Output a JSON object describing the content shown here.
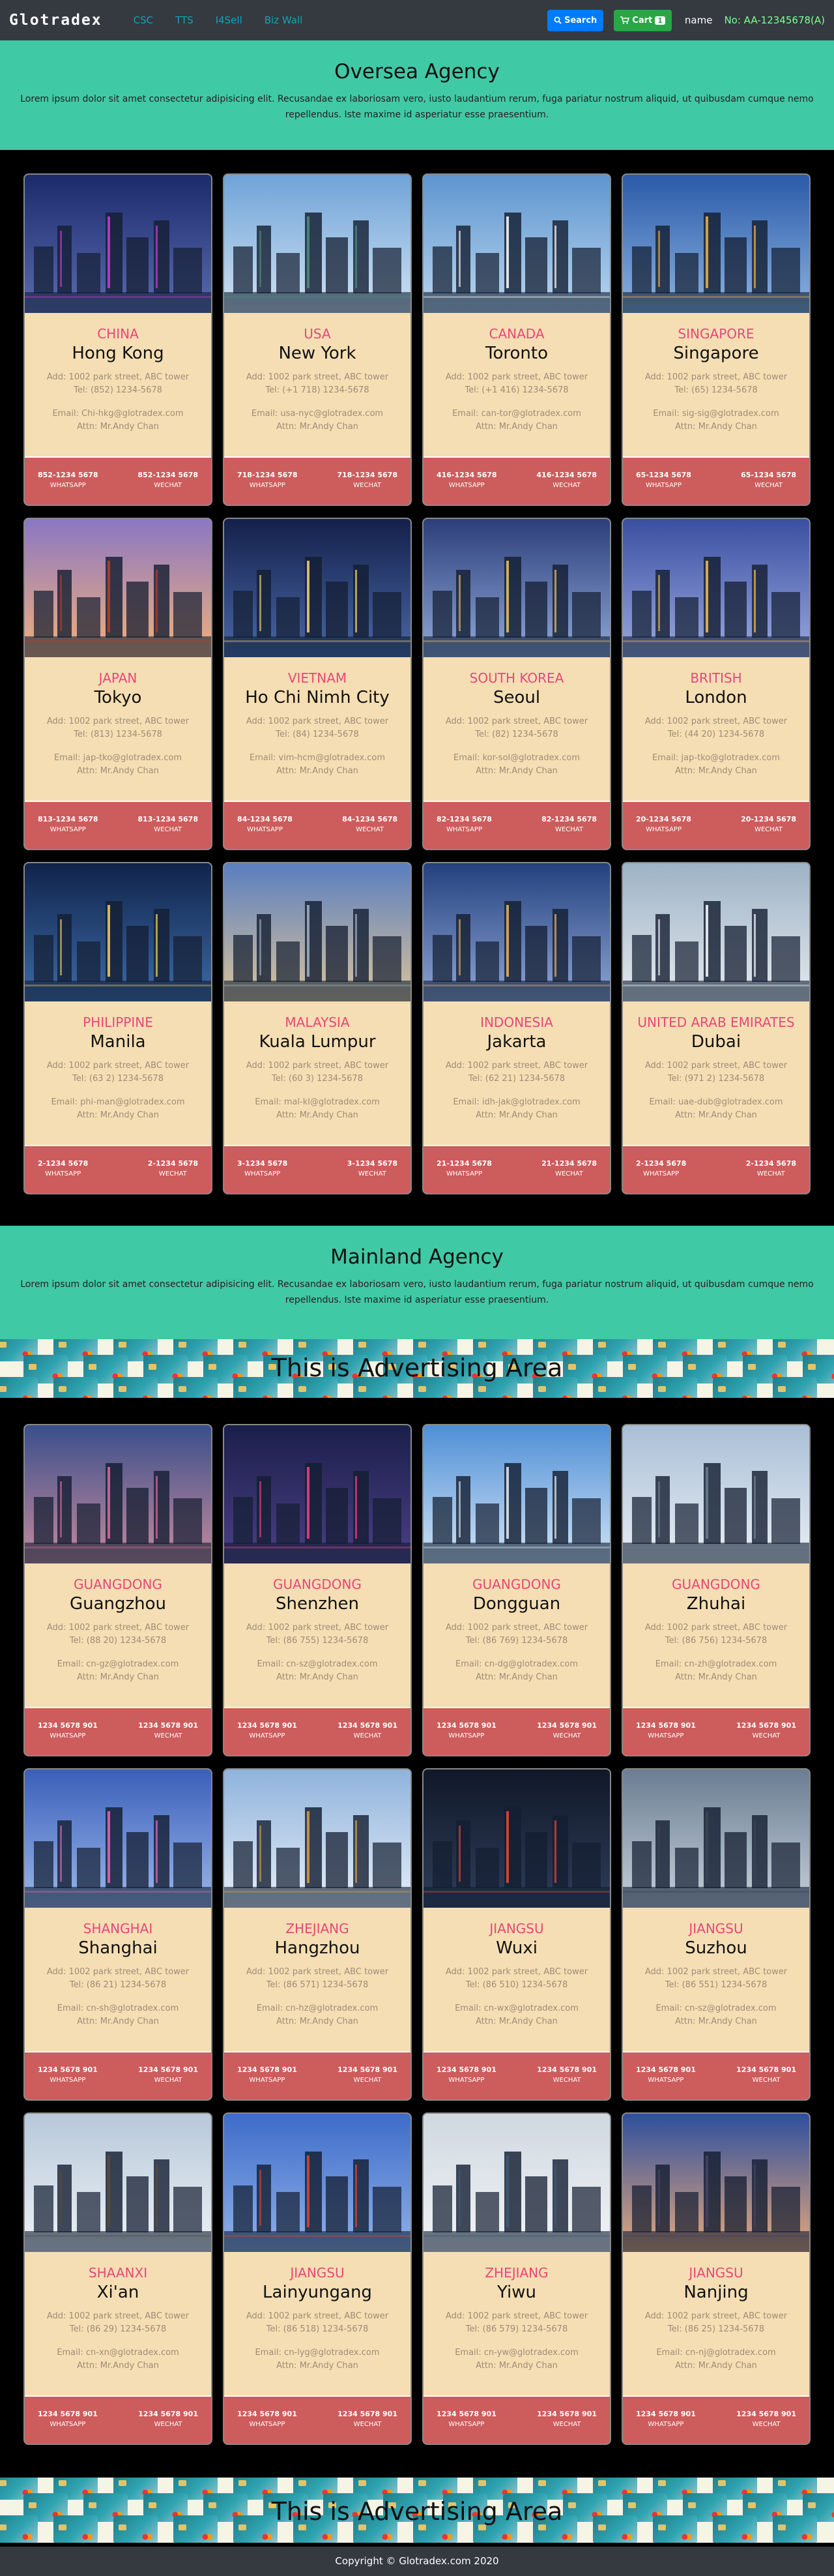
{
  "navbar": {
    "brand": "Glotradex",
    "links": [
      "CSC",
      "TTS",
      "I4Sell",
      "Biz Wall"
    ],
    "search_label": "Search",
    "cart_label": "Cart",
    "cart_count": "1",
    "user_name": "name",
    "user_no": "No: AA-12345678(A)"
  },
  "oversea": {
    "title": "Oversea Agency",
    "desc": "Lorem ipsum dolor sit amet consectetur adipisicing elit. Recusandae ex laboriosam vero, iusto laudantium rerum, fuga pariatur nostrum aliquid, ut quibusdam cumque nemo repellendus. Iste maxime id asperiatur esse praesentium.",
    "cards": [
      {
        "country": "CHINA",
        "city": "Hong Kong",
        "addr": "Add: 1002 park street, ABC tower",
        "tel": "Tel: (852) 1234-5678",
        "email": "Email: Chi-hkg@glotradex.com",
        "attn": "Attn: Mr.Andy Chan",
        "wa": "852-1234 5678",
        "wc": "852-1234 5678",
        "wa_label": "WHATSAPP",
        "wc_label": "WECHAT",
        "sky": [
          "#1b2a6b",
          "#5b6bb0"
        ],
        "accent": "#d23ad0"
      },
      {
        "country": "USA",
        "city": "New York",
        "addr": "Add: 1002 park street, ABC tower",
        "tel": "Tel: (+1 718) 1234-5678",
        "email": "Email: usa-nyc@glotradex.com",
        "attn": "Attn: Mr.Andy Chan",
        "wa": "718-1234 5678",
        "wc": "718-1234 5678",
        "wa_label": "WHATSAPP",
        "wc_label": "WECHAT",
        "sky": [
          "#6fa3d8",
          "#cfe2f2"
        ],
        "accent": "#4b8f7c"
      },
      {
        "country": "CANADA",
        "city": "Toronto",
        "addr": "Add: 1002 park street, ABC tower",
        "tel": "Tel: (+1 416) 1234-5678",
        "email": "Email: can-tor@glotradex.com",
        "attn": "Attn: Mr.Andy Chan",
        "wa": "416-1234 5678",
        "wc": "416-1234 5678",
        "wa_label": "WHATSAPP",
        "wc_label": "WECHAT",
        "sky": [
          "#5d95cf",
          "#b9d6ee"
        ],
        "accent": "#ffffff"
      },
      {
        "country": "SINGAPORE",
        "city": "Singapore",
        "addr": "Add: 1002 park street, ABC tower",
        "tel": "Tel: (65) 1234-5678",
        "email": "Email: sig-sig@glotradex.com",
        "attn": "Attn: Mr.Andy Chan",
        "wa": "65-1234 5678",
        "wc": "65-1234 5678",
        "wa_label": "WHATSAPP",
        "wc_label": "WECHAT",
        "sky": [
          "#2a5aa8",
          "#8bb3e2"
        ],
        "accent": "#f2b540"
      },
      {
        "country": "JAPAN",
        "city": "Tokyo",
        "addr": "Add: 1002 park street, ABC tower",
        "tel": "Tel: (813) 1234-5678",
        "email": "Email: jap-tko@glotradex.com",
        "attn": "Attn: Mr.Andy Chan",
        "wa": "813-1234 5678",
        "wc": "813-1234 5678",
        "wa_label": "WHATSAPP",
        "wc_label": "WECHAT",
        "sky": [
          "#8a77c4",
          "#f2b07a"
        ],
        "accent": "#c0392b"
      },
      {
        "country": "VIETNAM",
        "city": "Ho Chi Nimh City",
        "addr": "Add: 1002 park street, ABC tower",
        "tel": "Tel: (84) 1234-5678",
        "email": "Email: vim-hcm@glotradex.com",
        "attn": "Attn: Mr.Andy Chan",
        "wa": "84-1234 5678",
        "wc": "84-1234 5678",
        "wa_label": "WHATSAPP",
        "wc_label": "WECHAT",
        "sky": [
          "#14204a",
          "#4968a8"
        ],
        "accent": "#f5d76e"
      },
      {
        "country": "SOUTH KOREA",
        "city": "Seoul",
        "addr": "Add: 1002 park street, ABC tower",
        "tel": "Tel: (82) 1234-5678",
        "email": "Email: kor-sol@glotradex.com",
        "attn": "Attn: Mr.Andy Chan",
        "wa": "82-1234 5678",
        "wc": "82-1234 5678",
        "wa_label": "WHATSAPP",
        "wc_label": "WECHAT",
        "sky": [
          "#2c3e7a",
          "#8fa8d8"
        ],
        "accent": "#f0c36a"
      },
      {
        "country": "BRITISH",
        "city": "London",
        "addr": "Add: 1002 park street, ABC tower",
        "tel": "Tel: (44 20) 1234-5678",
        "email": "Email: jap-tko@glotradex.com",
        "attn": "Attn: Mr.Andy Chan",
        "wa": "20-1234 5678",
        "wc": "20-1234 5678",
        "wa_label": "WHATSAPP",
        "wc_label": "WECHAT",
        "sky": [
          "#3a4fa0",
          "#9aa8e0"
        ],
        "accent": "#f3c04a"
      },
      {
        "country": "PHILIPPINE",
        "city": "Manila",
        "addr": "Add: 1002 park street, ABC tower",
        "tel": "Tel: (63 2) 1234-5678",
        "email": "Email: phi-man@glotradex.com",
        "attn": "Attn: Mr.Andy Chan",
        "wa": "2-1234 5678",
        "wc": "2-1234 5678",
        "wa_label": "WHATSAPP",
        "wc_label": "WECHAT",
        "sky": [
          "#10244a",
          "#3d6aa8"
        ],
        "accent": "#f4d25a"
      },
      {
        "country": "MALAYSIA",
        "city": "Kuala Lumpur",
        "addr": "Add: 1002 park street, ABC tower",
        "tel": "Tel: (60 3) 1234-5678",
        "email": "Email: mal-kl@glotradex.com",
        "attn": "Attn: Mr.Andy Chan",
        "wa": "3-1234 5678",
        "wc": "3-1234 5678",
        "wa_label": "WHATSAPP",
        "wc_label": "WECHAT",
        "sky": [
          "#5a7ec0",
          "#d9c49a"
        ],
        "accent": "#a4b3c4"
      },
      {
        "country": "INDONESIA",
        "city": "Jakarta",
        "addr": "Add: 1002 park street, ABC tower",
        "tel": "Tel: (62 21) 1234-5678",
        "email": "Email: idh-jak@glotradex.com",
        "attn": "Attn: Mr.Andy Chan",
        "wa": "21-1234 5678",
        "wc": "21-1234 5678",
        "wa_label": "WHATSAPP",
        "wc_label": "WECHAT",
        "sky": [
          "#24417e",
          "#8ea6d6"
        ],
        "accent": "#e8b66a"
      },
      {
        "country": "UNITED ARAB EMIRATES",
        "city": "Dubai",
        "addr": "Add: 1002 park street, ABC tower",
        "tel": "Tel: (971 2) 1234-5678",
        "email": "Email: uae-dub@glotradex.com",
        "attn": "Attn: Mr.Andy Chan",
        "wa": "2-1234 5678",
        "wc": "2-1234 5678",
        "wa_label": "WHATSAPP",
        "wc_label": "WECHAT",
        "sky": [
          "#9eb3c6",
          "#e4e9ee"
        ],
        "accent": "#ffffff"
      }
    ]
  },
  "mainland": {
    "title": "Mainland Agency",
    "desc": "Lorem ipsum dolor sit amet consectetur adipisicing elit. Recusandae ex laboriosam vero, iusto laudantium rerum, fuga pariatur nostrum aliquid, ut quibusdam cumque nemo repellendus. Iste maxime id asperiatur esse praesentium.",
    "cards": [
      {
        "country": "GUANGDONG",
        "city": "Guangzhou",
        "addr": "Add: 1002 park street, ABC tower",
        "tel": "Tel: (88 20) 1234-5678",
        "email": "Email: cn-gz@glotradex.com",
        "attn": "Attn: Mr.Andy Chan",
        "wa": "1234 5678 901",
        "wc": "1234 5678 901",
        "wa_label": "WHATSAPP",
        "wc_label": "WECHAT",
        "sky": [
          "#3a4f8a",
          "#c58a9e"
        ],
        "accent": "#e46aa0"
      },
      {
        "country": "GUANGDONG",
        "city": "Shenzhen",
        "addr": "Add: 1002 park street, ABC tower",
        "tel": "Tel: (86 755) 1234-5678",
        "email": "Email: cn-sz@glotradex.com",
        "attn": "Attn: Mr.Andy Chan",
        "wa": "1234 5678 901",
        "wc": "1234 5678 901",
        "wa_label": "WHATSAPP",
        "wc_label": "WECHAT",
        "sky": [
          "#1a1f4a",
          "#4c3f86"
        ],
        "accent": "#ff3b8a"
      },
      {
        "country": "GUANGDONG",
        "city": "Dongguan",
        "addr": "Add: 1002 park street, ABC tower",
        "tel": "Tel: (86 769) 1234-5678",
        "email": "Email: cn-dg@glotradex.com",
        "attn": "Attn: Mr.Andy Chan",
        "wa": "1234 5678 901",
        "wc": "1234 5678 901",
        "wa_label": "WHATSAPP",
        "wc_label": "WECHAT",
        "sky": [
          "#4f8fd6",
          "#cfe3f5"
        ],
        "accent": "#e8eef4"
      },
      {
        "country": "GUANGDONG",
        "city": "Zhuhai",
        "addr": "Add: 1002 park street, ABC tower",
        "tel": "Tel: (86 756) 1234-5678",
        "email": "Email: cn-zh@glotradex.com",
        "attn": "Attn: Mr.Andy Chan",
        "wa": "1234 5678 901",
        "wc": "1234 5678 901",
        "wa_label": "WHATSAPP",
        "wc_label": "WECHAT",
        "sky": [
          "#a9bfd6",
          "#e8eef4"
        ],
        "accent": "#6c7f92"
      },
      {
        "country": "SHANGHAI",
        "city": "Shanghai",
        "addr": "Add: 1002 park street, ABC tower",
        "tel": "Tel: (86 21) 1234-5678",
        "email": "Email: cn-sh@glotradex.com",
        "attn": "Attn: Mr.Andy Chan",
        "wa": "1234 5678 901",
        "wc": "1234 5678 901",
        "wa_label": "WHATSAPP",
        "wc_label": "WECHAT",
        "sky": [
          "#3b5fb8",
          "#9bb7ec"
        ],
        "accent": "#e66ab8"
      },
      {
        "country": "ZHEJIANG",
        "city": "Hangzhou",
        "addr": "Add: 1002 park street, ABC tower",
        "tel": "Tel: (86 571) 1234-5678",
        "email": "Email: cn-hz@glotradex.com",
        "attn": "Attn: Mr.Andy Chan",
        "wa": "1234 5678 901",
        "wc": "1234 5678 901",
        "wa_label": "WHATSAPP",
        "wc_label": "WECHAT",
        "sky": [
          "#8fb3dc",
          "#e5eef7"
        ],
        "accent": "#d9a23a"
      },
      {
        "country": "JIANGSU",
        "city": "Wuxi",
        "addr": "Add: 1002 park street, ABC tower",
        "tel": "Tel: (86 510) 1234-5678",
        "email": "Email: cn-wx@glotradex.com",
        "attn": "Attn: Mr.Andy Chan",
        "wa": "1234 5678 901",
        "wc": "1234 5678 901",
        "wa_label": "WHATSAPP",
        "wc_label": "WECHAT",
        "sky": [
          "#101828",
          "#2f3e5a"
        ],
        "accent": "#e84a3a"
      },
      {
        "country": "JIANGSU",
        "city": "Suzhou",
        "addr": "Add: 1002 park street, ABC tower",
        "tel": "Tel: (86 551) 1234-5678",
        "email": "Email: cn-sz@glotradex.com",
        "attn": "Attn: Mr.Andy Chan",
        "wa": "1234 5678 901",
        "wc": "1234 5678 901",
        "wa_label": "WHATSAPP",
        "wc_label": "WECHAT",
        "sky": [
          "#6a7d92",
          "#c6d0da"
        ],
        "accent": "#3a4652"
      },
      {
        "country": "SHAANXI",
        "city": "Xi'an",
        "addr": "Add: 1002 park street, ABC tower",
        "tel": "Tel: (86 29) 1234-5678",
        "email": "Email: cn-xn@glotradex.com",
        "attn": "Attn: Mr.Andy Chan",
        "wa": "1234 5678 901",
        "wc": "1234 5678 901",
        "wa_label": "WHATSAPP",
        "wc_label": "WECHAT",
        "sky": [
          "#b7c8da",
          "#eef2f5"
        ],
        "accent": "#5a4a3a"
      },
      {
        "country": "JIANGSU",
        "city": "Lainyungang",
        "addr": "Add: 1002 park street, ABC tower",
        "tel": "Tel: (86 518) 1234-5678",
        "email": "Email: cn-lyg@glotradex.com",
        "attn": "Attn: Mr.Andy Chan",
        "wa": "1234 5678 901",
        "wc": "1234 5678 901",
        "wa_label": "WHATSAPP",
        "wc_label": "WECHAT",
        "sky": [
          "#3e6cc8",
          "#8fb1ea"
        ],
        "accent": "#e2452c"
      },
      {
        "country": "ZHEJIANG",
        "city": "Yiwu",
        "addr": "Add: 1002 park street, ABC tower",
        "tel": "Tel: (86 579) 1234-5678",
        "email": "Email: cn-yw@glotradex.com",
        "attn": "Attn: Mr.Andy Chan",
        "wa": "1234 5678 901",
        "wc": "1234 5678 901",
        "wa_label": "WHATSAPP",
        "wc_label": "WECHAT",
        "sky": [
          "#cfd8e0",
          "#f2f4f6"
        ],
        "accent": "#3c5a78"
      },
      {
        "country": "JIANGSU",
        "city": "Nanjing",
        "addr": "Add: 1002 park street, ABC tower",
        "tel": "Tel: (86 25) 1234-5678",
        "email": "Email: cn-nj@glotradex.com",
        "attn": "Attn: Mr.Andy Chan",
        "wa": "1234 5678 901",
        "wc": "1234 5678 901",
        "wa_label": "WHATSAPP",
        "wc_label": "WECHAT",
        "sky": [
          "#2e4f9e",
          "#e6a87a"
        ],
        "accent": "#4a3f6a"
      }
    ]
  },
  "ad": {
    "text": "This is Advertising Area"
  },
  "footer": {
    "text": "Copyright © Glotradex.com 2020"
  }
}
